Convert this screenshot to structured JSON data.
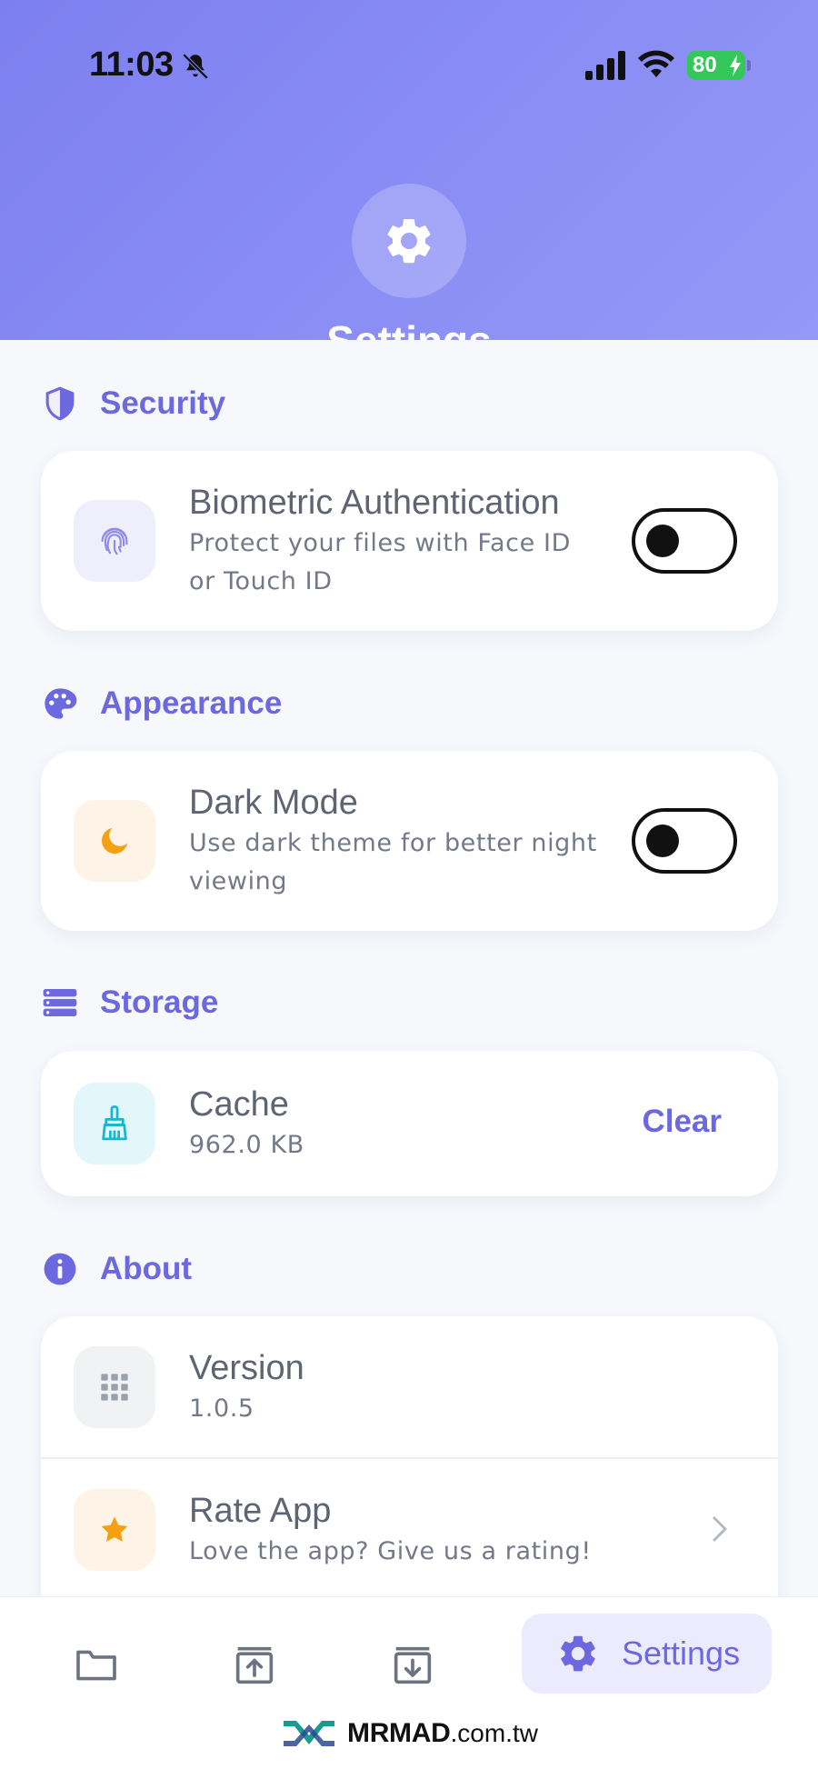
{
  "status_bar": {
    "time": "11:03",
    "battery": "80"
  },
  "header": {
    "title": "Settings"
  },
  "sections": {
    "security": {
      "label": "Security",
      "biometric": {
        "title": "Biometric Authentication",
        "subtitle_line1": "Protect your files with Face ID",
        "subtitle_line2": "or Touch ID",
        "enabled": false
      }
    },
    "appearance": {
      "label": "Appearance",
      "dark_mode": {
        "title": "Dark Mode",
        "subtitle_line1": "Use dark theme for better night",
        "subtitle_line2": "viewing",
        "enabled": false
      }
    },
    "storage": {
      "label": "Storage",
      "cache": {
        "title": "Cache",
        "size": "962.0 KB",
        "action": "Clear"
      }
    },
    "about": {
      "label": "About",
      "version": {
        "title": "Version",
        "value": "1.0.5"
      },
      "rate": {
        "title": "Rate App",
        "subtitle": "Love the app? Give us a rating!"
      }
    }
  },
  "tabbar": {
    "tabs": [
      {
        "icon": "folder-icon"
      },
      {
        "icon": "upload-icon"
      },
      {
        "icon": "download-icon"
      },
      {
        "icon": "settings-icon",
        "label": "Settings",
        "active": true
      }
    ]
  },
  "watermark": {
    "brand": "MRMAD",
    "domain": ".com.tw"
  },
  "colors": {
    "accent": "#6c68e0",
    "header_gradient_start": "#7c7ff0",
    "header_gradient_end": "#9598f6",
    "battery": "#34c759",
    "star": "#f5a011",
    "cache_icon": "#19b6cf"
  }
}
